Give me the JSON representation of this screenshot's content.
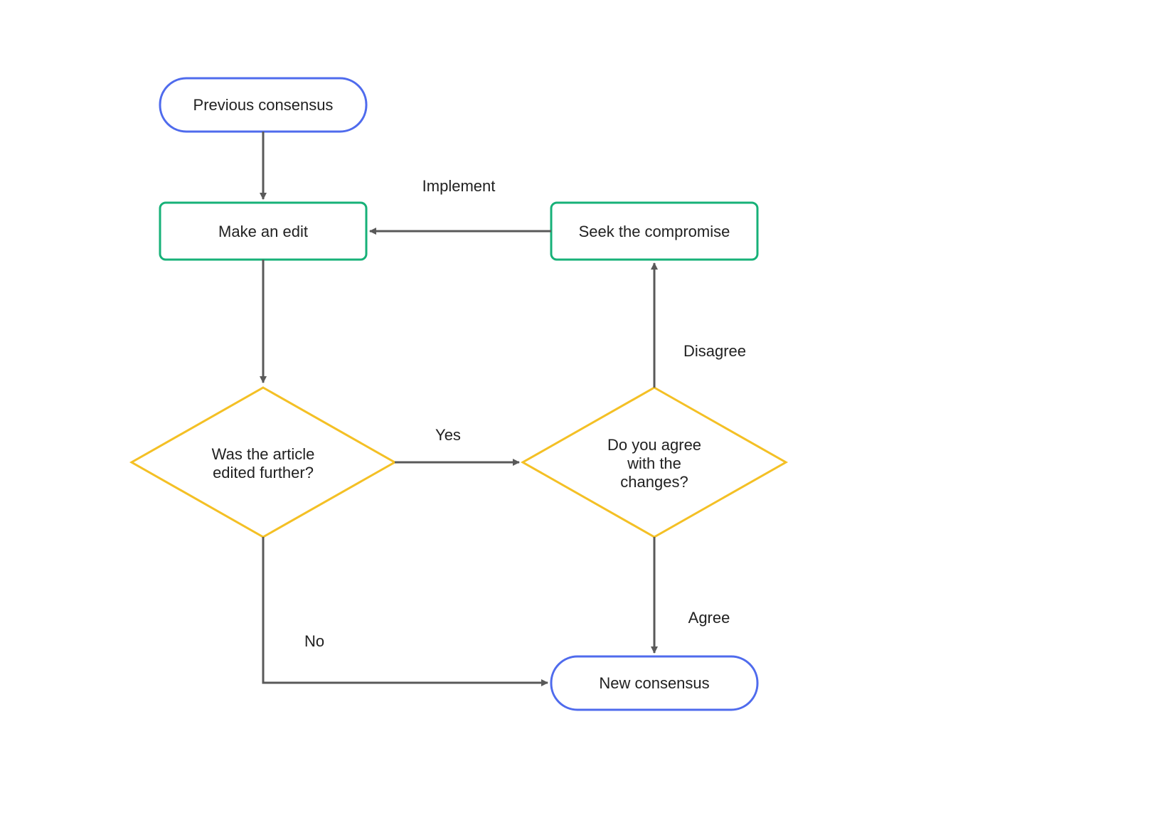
{
  "diagram": {
    "nodes": {
      "previous_consensus": {
        "label": "Previous consensus",
        "shape": "terminator",
        "color": "#4f6bed"
      },
      "make_edit": {
        "label": "Make an edit",
        "shape": "process",
        "color": "#17b178"
      },
      "seek_compromise": {
        "label": "Seek the compromise",
        "shape": "process",
        "color": "#17b178"
      },
      "was_edited": {
        "label_line1": "Was the article",
        "label_line2": "edited further?",
        "shape": "decision",
        "color": "#f4c025"
      },
      "agree_changes": {
        "label_line1": "Do you agree",
        "label_line2": "with the",
        "label_line3": "changes?",
        "shape": "decision",
        "color": "#f4c025"
      },
      "new_consensus": {
        "label": "New consensus",
        "shape": "terminator",
        "color": "#4f6bed"
      }
    },
    "edges": {
      "implement": {
        "label": "Implement"
      },
      "yes": {
        "label": "Yes"
      },
      "no": {
        "label": "No"
      },
      "disagree": {
        "label": "Disagree"
      },
      "agree": {
        "label": "Agree"
      }
    },
    "colors": {
      "arrow": "#595959",
      "terminator_border": "#4f6bed",
      "process_border": "#17b178",
      "decision_border": "#f4c025"
    }
  }
}
